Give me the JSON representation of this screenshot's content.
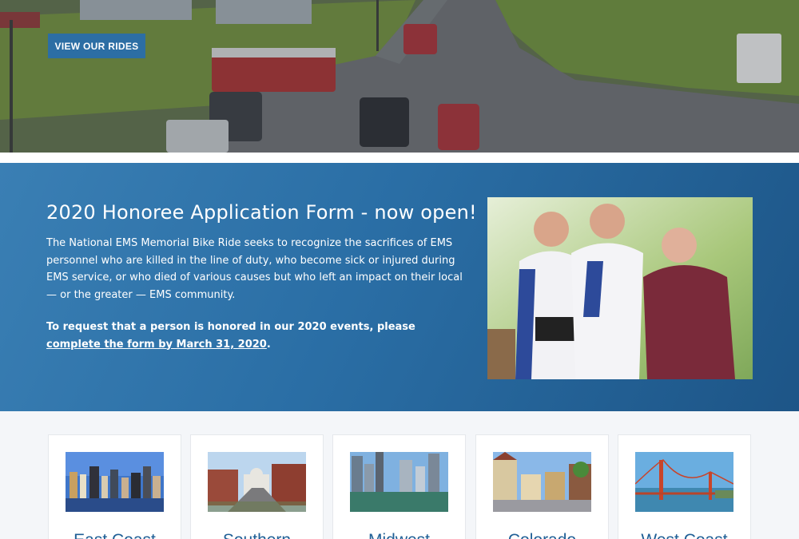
{
  "hero": {
    "button_label": "VIEW OUR RIDES",
    "image": "aerial-parking-lot-fire-trucks"
  },
  "banner": {
    "title": "2020 Honoree Application Form - now open!",
    "body": "The National EMS Memorial Bike Ride seeks to recognize the sacrifices of EMS personnel who are killed in the line of duty, who become sick or injured during EMS service, or who died of various causes but who left an impact on their local — or the greater — EMS community.",
    "cta_prefix": "To request that a person is honored in our 2020 events, please ",
    "cta_link": "complete the form by March 31, 2020",
    "cta_suffix": ".",
    "photo": "cyclists-presenting-medallion"
  },
  "regions": [
    {
      "label": "East Coast",
      "image": "boston-skyline"
    },
    {
      "label": "Southern",
      "image": "capitol-street"
    },
    {
      "label": "Midwest",
      "image": "chicago-river"
    },
    {
      "label": "Colorado",
      "image": "mountain-town-street"
    },
    {
      "label": "West Coast",
      "image": "golden-gate-bridge"
    }
  ],
  "colors": {
    "accent": "#2c6ea4",
    "banner_start": "#3a7fb4",
    "banner_end": "#1d5587",
    "region_label": "#1f5f96"
  }
}
